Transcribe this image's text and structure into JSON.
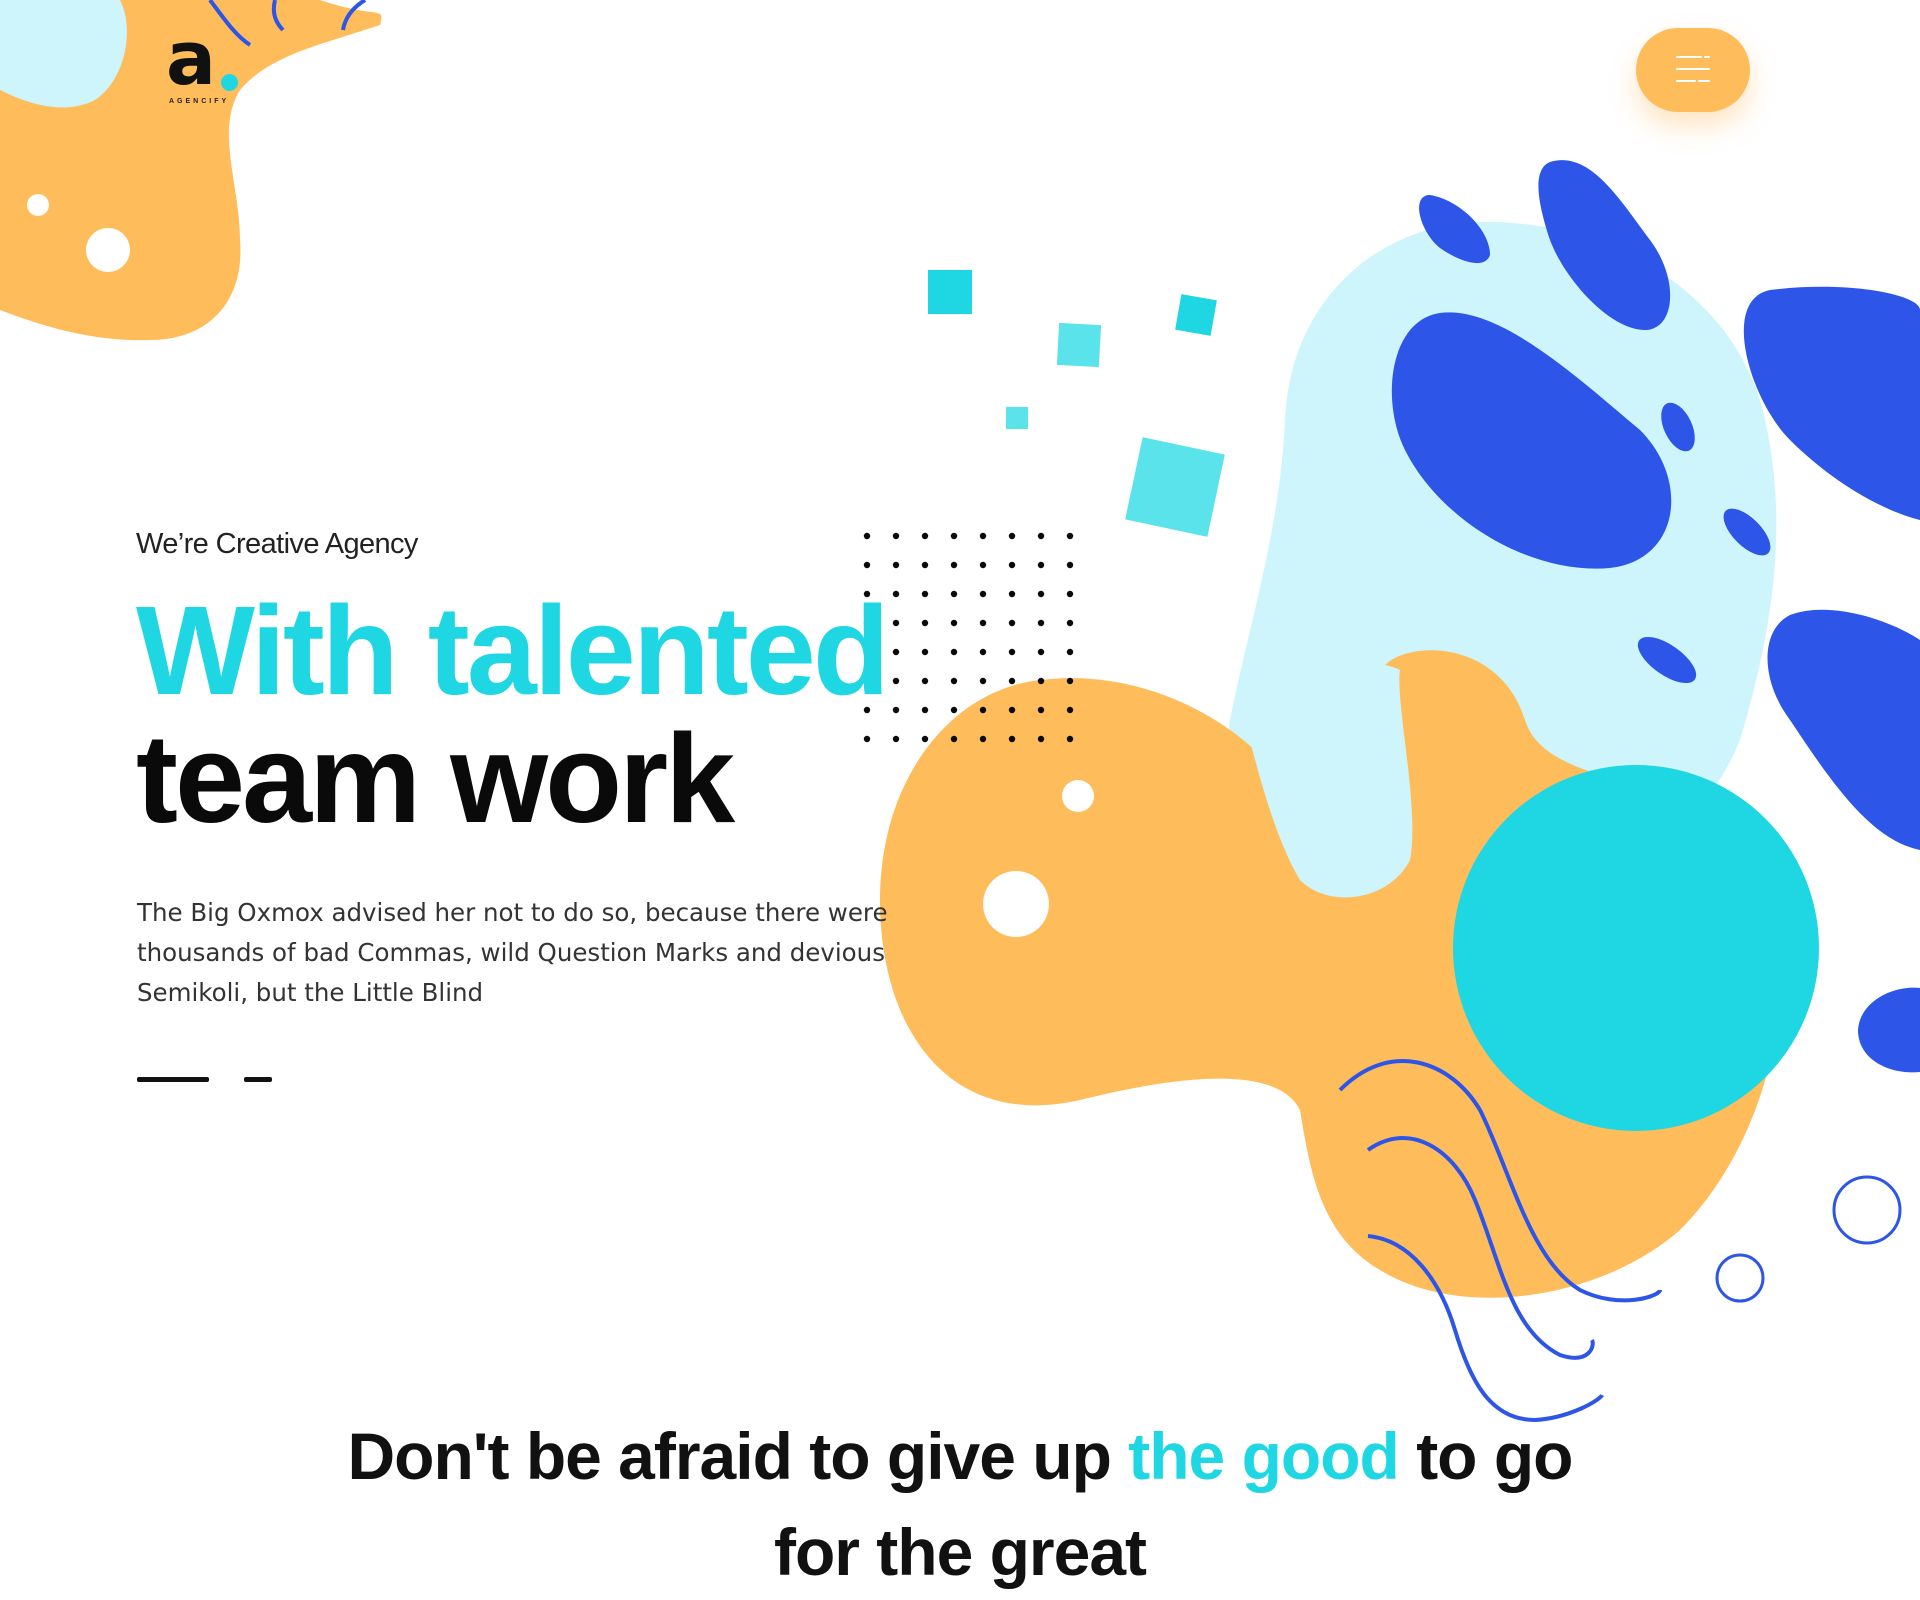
{
  "brand": {
    "logo_letter": "a",
    "logo_subtitle": "AGENCIFY"
  },
  "header": {
    "menu_icon": "hamburger-menu-icon"
  },
  "hero": {
    "tagline": "We’re Creative Agency",
    "title_line1": "With talented",
    "title_line2": "team work",
    "description": "The Big Oxmox advised her not to do so, because there were thousands of bad Commas, wild Question Marks and devious Semikoli, but the Little Blind",
    "slide_count": 2,
    "active_slide": 1
  },
  "quote": {
    "part1": "Don't be afraid to give up ",
    "highlight": "the good",
    "part2": " to go for the great"
  },
  "colors": {
    "cyan": "#1fd7e3",
    "orange": "#ffbc5b",
    "blue": "#2d55e8",
    "light_cyan": "#cdf5fb",
    "text": "#111111"
  }
}
